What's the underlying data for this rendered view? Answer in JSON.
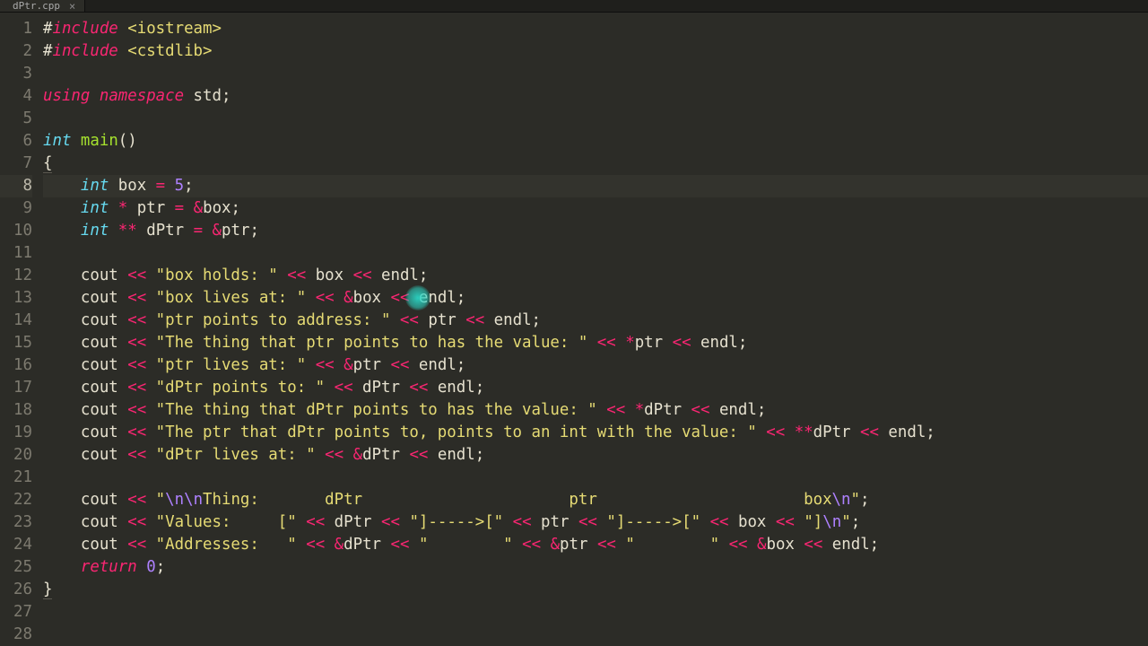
{
  "tab": {
    "filename": "dPtr.cpp",
    "close": "×"
  },
  "gutter": {
    "start": 1,
    "end": 28,
    "active": 8
  },
  "cursorHighlight": {
    "line_index": 12,
    "ch": 40
  },
  "code": [
    [
      {
        "c": "tk-preproc-hash",
        "t": "#"
      },
      {
        "c": "tk-preproc",
        "t": "include"
      },
      {
        "c": "tk-plain",
        "t": " "
      },
      {
        "c": "tk-string",
        "t": "<iostream>"
      }
    ],
    [
      {
        "c": "tk-preproc-hash",
        "t": "#"
      },
      {
        "c": "tk-preproc",
        "t": "include"
      },
      {
        "c": "tk-plain",
        "t": " "
      },
      {
        "c": "tk-string",
        "t": "<cstdlib>"
      }
    ],
    [],
    [
      {
        "c": "tk-keyword",
        "t": "using"
      },
      {
        "c": "tk-plain",
        "t": " "
      },
      {
        "c": "tk-keyword",
        "t": "namespace"
      },
      {
        "c": "tk-plain",
        "t": " std;"
      }
    ],
    [],
    [
      {
        "c": "tk-type",
        "t": "int"
      },
      {
        "c": "tk-plain",
        "t": " "
      },
      {
        "c": "tk-func",
        "t": "main"
      },
      {
        "c": "tk-plain",
        "t": "()"
      }
    ],
    [
      {
        "c": "tk-plain underline",
        "t": "{"
      }
    ],
    [
      {
        "c": "tk-plain",
        "t": "    "
      },
      {
        "c": "tk-type",
        "t": "int"
      },
      {
        "c": "tk-plain",
        "t": " box "
      },
      {
        "c": "tk-op",
        "t": "="
      },
      {
        "c": "tk-plain",
        "t": " "
      },
      {
        "c": "tk-num",
        "t": "5"
      },
      {
        "c": "tk-plain",
        "t": ";"
      }
    ],
    [
      {
        "c": "tk-plain",
        "t": "    "
      },
      {
        "c": "tk-type",
        "t": "int"
      },
      {
        "c": "tk-plain",
        "t": " "
      },
      {
        "c": "tk-op",
        "t": "*"
      },
      {
        "c": "tk-plain",
        "t": " ptr "
      },
      {
        "c": "tk-op",
        "t": "="
      },
      {
        "c": "tk-plain",
        "t": " "
      },
      {
        "c": "tk-op",
        "t": "&"
      },
      {
        "c": "tk-plain",
        "t": "box;"
      }
    ],
    [
      {
        "c": "tk-plain",
        "t": "    "
      },
      {
        "c": "tk-type",
        "t": "int"
      },
      {
        "c": "tk-plain",
        "t": " "
      },
      {
        "c": "tk-op",
        "t": "**"
      },
      {
        "c": "tk-plain",
        "t": " dPtr "
      },
      {
        "c": "tk-op",
        "t": "="
      },
      {
        "c": "tk-plain",
        "t": " "
      },
      {
        "c": "tk-op",
        "t": "&"
      },
      {
        "c": "tk-plain",
        "t": "ptr;"
      }
    ],
    [],
    [
      {
        "c": "tk-plain",
        "t": "    cout "
      },
      {
        "c": "tk-op",
        "t": "<<"
      },
      {
        "c": "tk-plain",
        "t": " "
      },
      {
        "c": "tk-string",
        "t": "\"box holds: \""
      },
      {
        "c": "tk-plain",
        "t": " "
      },
      {
        "c": "tk-op",
        "t": "<<"
      },
      {
        "c": "tk-plain",
        "t": " box "
      },
      {
        "c": "tk-op",
        "t": "<<"
      },
      {
        "c": "tk-plain",
        "t": " endl;"
      }
    ],
    [
      {
        "c": "tk-plain",
        "t": "    cout "
      },
      {
        "c": "tk-op",
        "t": "<<"
      },
      {
        "c": "tk-plain",
        "t": " "
      },
      {
        "c": "tk-string",
        "t": "\"box lives at: \""
      },
      {
        "c": "tk-plain",
        "t": " "
      },
      {
        "c": "tk-op",
        "t": "<<"
      },
      {
        "c": "tk-plain",
        "t": " "
      },
      {
        "c": "tk-op",
        "t": "&"
      },
      {
        "c": "tk-plain",
        "t": "box "
      },
      {
        "c": "tk-op",
        "t": "<<"
      },
      {
        "c": "tk-plain",
        "t": " endl;"
      }
    ],
    [
      {
        "c": "tk-plain",
        "t": "    cout "
      },
      {
        "c": "tk-op",
        "t": "<<"
      },
      {
        "c": "tk-plain",
        "t": " "
      },
      {
        "c": "tk-string",
        "t": "\"ptr points to address: \""
      },
      {
        "c": "tk-plain",
        "t": " "
      },
      {
        "c": "tk-op",
        "t": "<<"
      },
      {
        "c": "tk-plain",
        "t": " ptr "
      },
      {
        "c": "tk-op",
        "t": "<<"
      },
      {
        "c": "tk-plain",
        "t": " endl;"
      }
    ],
    [
      {
        "c": "tk-plain",
        "t": "    cout "
      },
      {
        "c": "tk-op",
        "t": "<<"
      },
      {
        "c": "tk-plain",
        "t": " "
      },
      {
        "c": "tk-string",
        "t": "\"The thing that ptr points to has the value: \""
      },
      {
        "c": "tk-plain",
        "t": " "
      },
      {
        "c": "tk-op",
        "t": "<<"
      },
      {
        "c": "tk-plain",
        "t": " "
      },
      {
        "c": "tk-op",
        "t": "*"
      },
      {
        "c": "tk-plain",
        "t": "ptr "
      },
      {
        "c": "tk-op",
        "t": "<<"
      },
      {
        "c": "tk-plain",
        "t": " endl;"
      }
    ],
    [
      {
        "c": "tk-plain",
        "t": "    cout "
      },
      {
        "c": "tk-op",
        "t": "<<"
      },
      {
        "c": "tk-plain",
        "t": " "
      },
      {
        "c": "tk-string",
        "t": "\"ptr lives at: \""
      },
      {
        "c": "tk-plain",
        "t": " "
      },
      {
        "c": "tk-op",
        "t": "<<"
      },
      {
        "c": "tk-plain",
        "t": " "
      },
      {
        "c": "tk-op",
        "t": "&"
      },
      {
        "c": "tk-plain",
        "t": "ptr "
      },
      {
        "c": "tk-op",
        "t": "<<"
      },
      {
        "c": "tk-plain",
        "t": " endl;"
      }
    ],
    [
      {
        "c": "tk-plain",
        "t": "    cout "
      },
      {
        "c": "tk-op",
        "t": "<<"
      },
      {
        "c": "tk-plain",
        "t": " "
      },
      {
        "c": "tk-string",
        "t": "\"dPtr points to: \""
      },
      {
        "c": "tk-plain",
        "t": " "
      },
      {
        "c": "tk-op",
        "t": "<<"
      },
      {
        "c": "tk-plain",
        "t": " dPtr "
      },
      {
        "c": "tk-op",
        "t": "<<"
      },
      {
        "c": "tk-plain",
        "t": " endl;"
      }
    ],
    [
      {
        "c": "tk-plain",
        "t": "    cout "
      },
      {
        "c": "tk-op",
        "t": "<<"
      },
      {
        "c": "tk-plain",
        "t": " "
      },
      {
        "c": "tk-string",
        "t": "\"The thing that dPtr points to has the value: \""
      },
      {
        "c": "tk-plain",
        "t": " "
      },
      {
        "c": "tk-op",
        "t": "<<"
      },
      {
        "c": "tk-plain",
        "t": " "
      },
      {
        "c": "tk-op",
        "t": "*"
      },
      {
        "c": "tk-plain",
        "t": "dPtr "
      },
      {
        "c": "tk-op",
        "t": "<<"
      },
      {
        "c": "tk-plain",
        "t": " endl;"
      }
    ],
    [
      {
        "c": "tk-plain",
        "t": "    cout "
      },
      {
        "c": "tk-op",
        "t": "<<"
      },
      {
        "c": "tk-plain",
        "t": " "
      },
      {
        "c": "tk-string",
        "t": "\"The ptr that dPtr points to, points to an int with the value: \""
      },
      {
        "c": "tk-plain",
        "t": " "
      },
      {
        "c": "tk-op",
        "t": "<<"
      },
      {
        "c": "tk-plain",
        "t": " "
      },
      {
        "c": "tk-op",
        "t": "**"
      },
      {
        "c": "tk-plain",
        "t": "dPtr "
      },
      {
        "c": "tk-op",
        "t": "<<"
      },
      {
        "c": "tk-plain",
        "t": " endl;"
      }
    ],
    [
      {
        "c": "tk-plain",
        "t": "    cout "
      },
      {
        "c": "tk-op",
        "t": "<<"
      },
      {
        "c": "tk-plain",
        "t": " "
      },
      {
        "c": "tk-string",
        "t": "\"dPtr lives at: \""
      },
      {
        "c": "tk-plain",
        "t": " "
      },
      {
        "c": "tk-op",
        "t": "<<"
      },
      {
        "c": "tk-plain",
        "t": " "
      },
      {
        "c": "tk-op",
        "t": "&"
      },
      {
        "c": "tk-plain",
        "t": "dPtr "
      },
      {
        "c": "tk-op",
        "t": "<<"
      },
      {
        "c": "tk-plain",
        "t": " endl;"
      }
    ],
    [],
    [
      {
        "c": "tk-plain",
        "t": "    cout "
      },
      {
        "c": "tk-op",
        "t": "<<"
      },
      {
        "c": "tk-plain",
        "t": " "
      },
      {
        "c": "tk-qmark",
        "t": "\""
      },
      {
        "c": "tk-escape",
        "t": "\\n\\n"
      },
      {
        "c": "tk-string",
        "t": "Thing:       dPtr                      ptr                      box"
      },
      {
        "c": "tk-escape",
        "t": "\\n"
      },
      {
        "c": "tk-qmark",
        "t": "\""
      },
      {
        "c": "tk-plain",
        "t": ";"
      }
    ],
    [
      {
        "c": "tk-plain",
        "t": "    cout "
      },
      {
        "c": "tk-op",
        "t": "<<"
      },
      {
        "c": "tk-plain",
        "t": " "
      },
      {
        "c": "tk-string",
        "t": "\"Values:     [\""
      },
      {
        "c": "tk-plain",
        "t": " "
      },
      {
        "c": "tk-op",
        "t": "<<"
      },
      {
        "c": "tk-plain",
        "t": " dPtr "
      },
      {
        "c": "tk-op",
        "t": "<<"
      },
      {
        "c": "tk-plain",
        "t": " "
      },
      {
        "c": "tk-string",
        "t": "\"]----->[\""
      },
      {
        "c": "tk-plain",
        "t": " "
      },
      {
        "c": "tk-op",
        "t": "<<"
      },
      {
        "c": "tk-plain",
        "t": " ptr "
      },
      {
        "c": "tk-op",
        "t": "<<"
      },
      {
        "c": "tk-plain",
        "t": " "
      },
      {
        "c": "tk-string",
        "t": "\"]----->[\""
      },
      {
        "c": "tk-plain",
        "t": " "
      },
      {
        "c": "tk-op",
        "t": "<<"
      },
      {
        "c": "tk-plain",
        "t": " box "
      },
      {
        "c": "tk-op",
        "t": "<<"
      },
      {
        "c": "tk-plain",
        "t": " "
      },
      {
        "c": "tk-string",
        "t": "\"]"
      },
      {
        "c": "tk-escape",
        "t": "\\n"
      },
      {
        "c": "tk-qmark",
        "t": "\""
      },
      {
        "c": "tk-plain",
        "t": ";"
      }
    ],
    [
      {
        "c": "tk-plain",
        "t": "    cout "
      },
      {
        "c": "tk-op",
        "t": "<<"
      },
      {
        "c": "tk-plain",
        "t": " "
      },
      {
        "c": "tk-string",
        "t": "\"Addresses:   \""
      },
      {
        "c": "tk-plain",
        "t": " "
      },
      {
        "c": "tk-op",
        "t": "<<"
      },
      {
        "c": "tk-plain",
        "t": " "
      },
      {
        "c": "tk-op",
        "t": "&"
      },
      {
        "c": "tk-plain",
        "t": "dPtr "
      },
      {
        "c": "tk-op",
        "t": "<<"
      },
      {
        "c": "tk-plain",
        "t": " "
      },
      {
        "c": "tk-string",
        "t": "\"        \""
      },
      {
        "c": "tk-plain",
        "t": " "
      },
      {
        "c": "tk-op",
        "t": "<<"
      },
      {
        "c": "tk-plain",
        "t": " "
      },
      {
        "c": "tk-op",
        "t": "&"
      },
      {
        "c": "tk-plain",
        "t": "ptr "
      },
      {
        "c": "tk-op",
        "t": "<<"
      },
      {
        "c": "tk-plain",
        "t": " "
      },
      {
        "c": "tk-string",
        "t": "\"        \""
      },
      {
        "c": "tk-plain",
        "t": " "
      },
      {
        "c": "tk-op",
        "t": "<<"
      },
      {
        "c": "tk-plain",
        "t": " "
      },
      {
        "c": "tk-op",
        "t": "&"
      },
      {
        "c": "tk-plain",
        "t": "box "
      },
      {
        "c": "tk-op",
        "t": "<<"
      },
      {
        "c": "tk-plain",
        "t": " endl;"
      }
    ],
    [
      {
        "c": "tk-plain",
        "t": "    "
      },
      {
        "c": "tk-return",
        "t": "return"
      },
      {
        "c": "tk-plain",
        "t": " "
      },
      {
        "c": "tk-num",
        "t": "0"
      },
      {
        "c": "tk-plain",
        "t": ";"
      }
    ],
    [
      {
        "c": "tk-plain underline",
        "t": "}"
      }
    ],
    [],
    []
  ]
}
